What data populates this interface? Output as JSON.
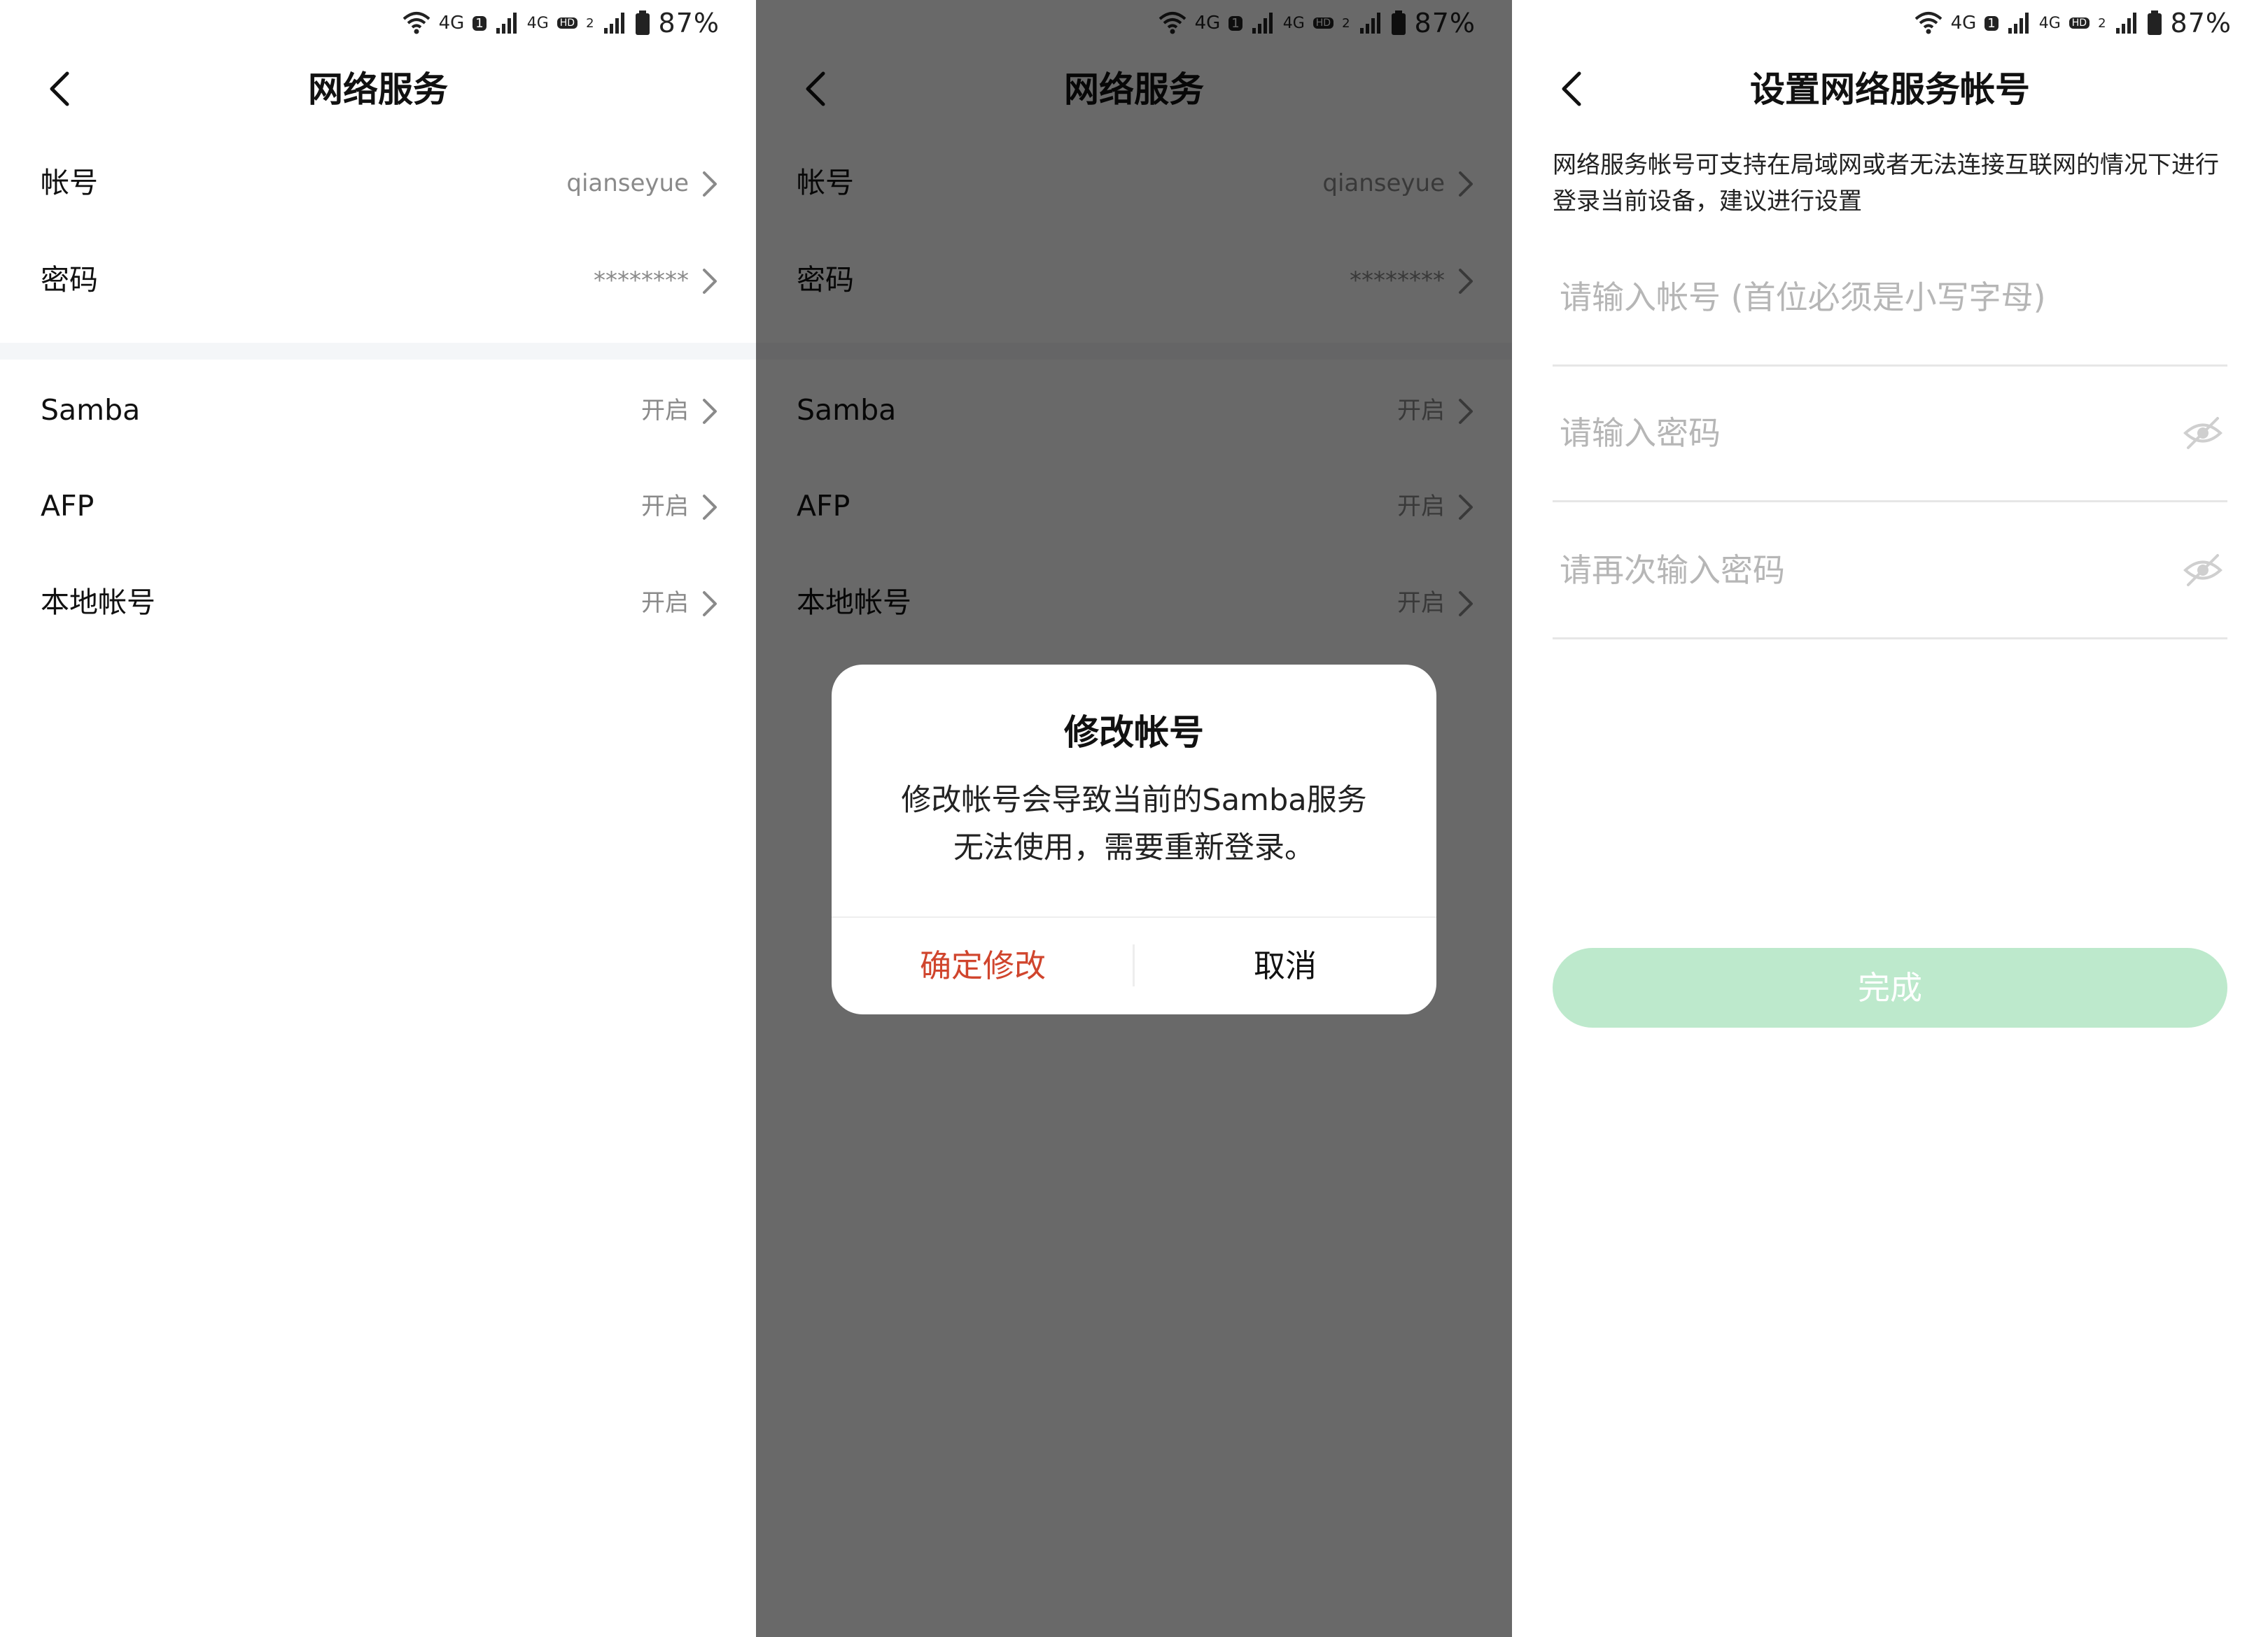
{
  "status_bar": {
    "battery": "87%",
    "network_1": "4G",
    "network_2": "4G",
    "network_2_sub": "HD",
    "sim_1": "1",
    "sim_2": "2",
    "icons": [
      "wifi-icon",
      "signal-icon",
      "battery-icon"
    ]
  },
  "network_services": {
    "title": "网络服务",
    "rows": [
      {
        "label": "帐号",
        "value": "qianseyue"
      },
      {
        "label": "密码",
        "value": "********"
      },
      {
        "label": "Samba",
        "value": "开启"
      },
      {
        "label": "AFP",
        "value": "开启"
      },
      {
        "label": "本地帐号",
        "value": "开启"
      }
    ]
  },
  "dialog": {
    "title": "修改帐号",
    "message_line_1": "修改帐号会导致当前的Samba服务",
    "message_line_2": "无法使用，需要重新登录。",
    "confirm_label": "确定修改",
    "cancel_label": "取消"
  },
  "account_setup": {
    "title": "设置网络服务帐号",
    "description": "网络服务帐号可支持在局域网或者无法连接互联网的情况下进行登录当前设备，建议进行设置",
    "account_placeholder": "请输入帐号 (首位必须是小写字母)",
    "password_placeholder": "请输入密码",
    "confirm_password_placeholder": "请再次输入密码",
    "done_label": "完成"
  },
  "colors": {
    "danger": "#d0452d",
    "done_button_disabled": "#bde9cc",
    "secondary_text": "#8a8a8a",
    "section_gap": "#f4f6f8"
  }
}
